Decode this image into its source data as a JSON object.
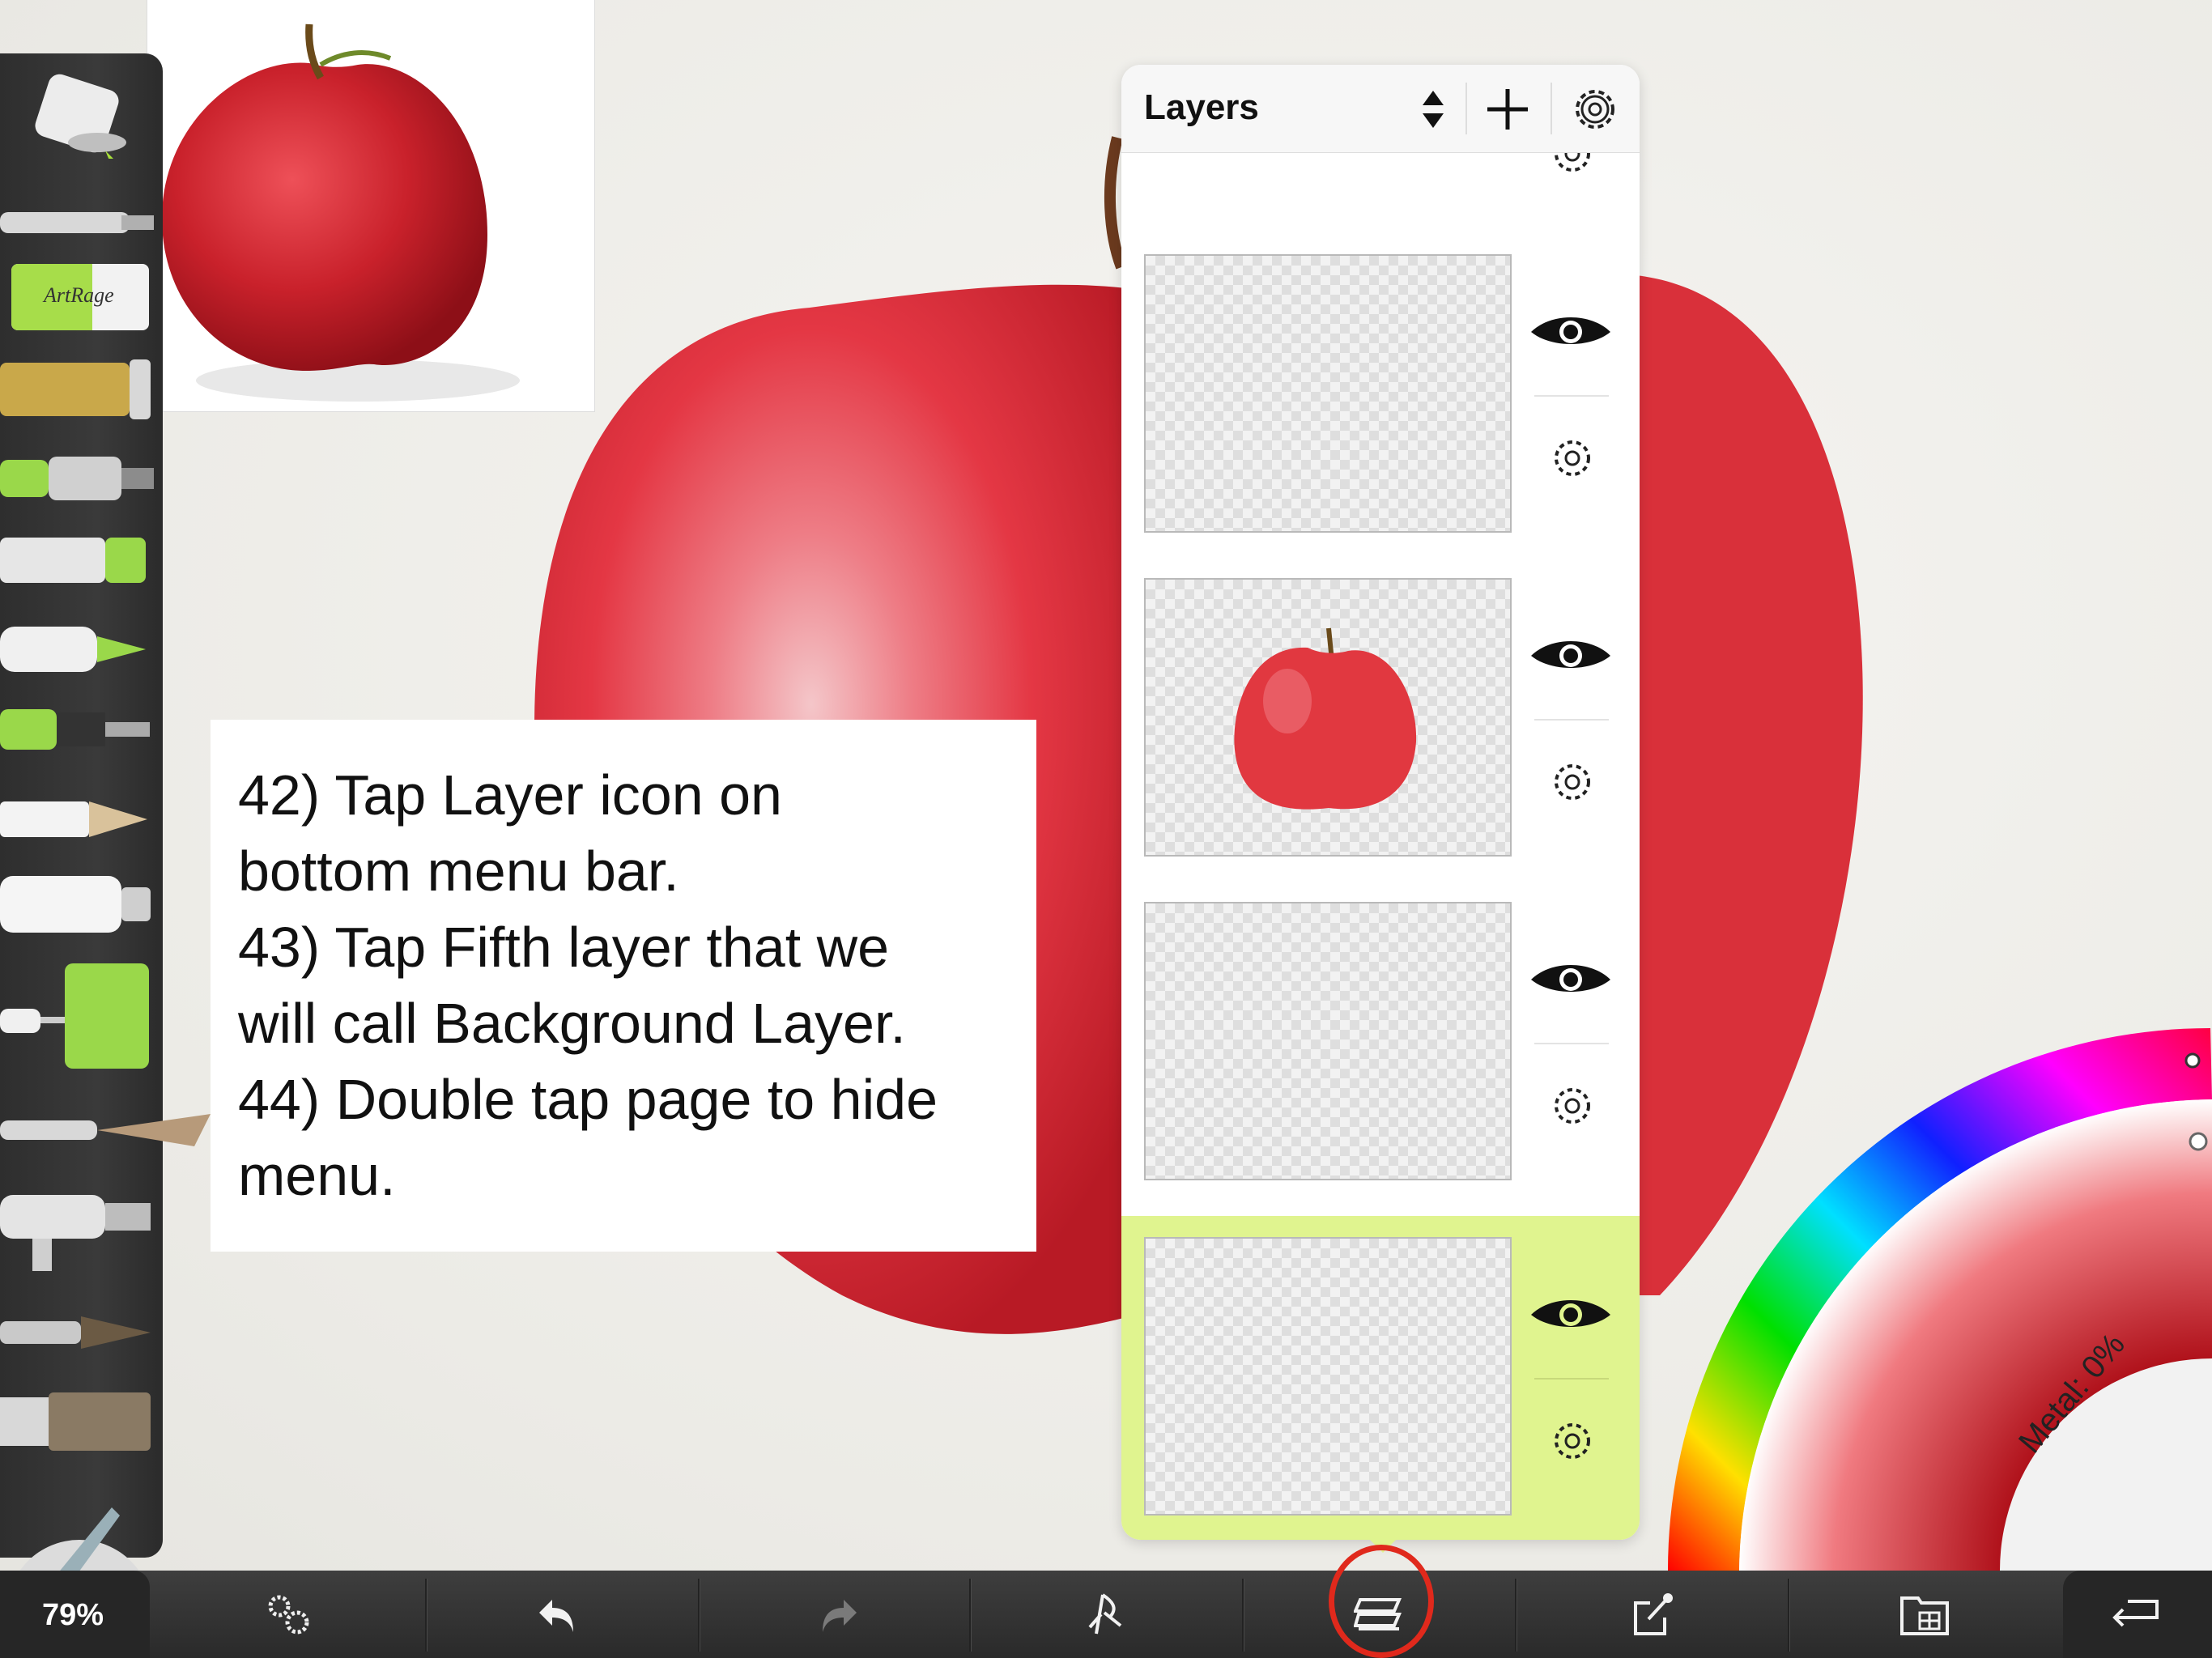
{
  "note": {
    "text": "42) Tap Layer icon on\nbottom menu bar.\n43) Tap Fifth layer that we\nwill call Background Layer.\n44) Double tap page to hide\nmenu."
  },
  "toolbox": {
    "tools": [
      "paint-roller-bucket",
      "palette-knife-pen",
      "eraser",
      "glitter-tube",
      "felt-pen",
      "crayon",
      "marker",
      "ink-pen",
      "pencil",
      "paint-tube",
      "paint-roller",
      "palette-knife",
      "airbrush",
      "watercolor-brush",
      "oil-brush"
    ],
    "eraser_brand": "ArtRage"
  },
  "layers_panel": {
    "title": "Layers",
    "layers": [
      {
        "visible": true,
        "selected": false,
        "content": "transparent"
      },
      {
        "visible": true,
        "selected": false,
        "content": "apple"
      },
      {
        "visible": true,
        "selected": false,
        "content": "transparent"
      },
      {
        "visible": true,
        "selected": true,
        "content": "transparent"
      }
    ]
  },
  "color_picker": {
    "metal_label": "Metal: 0%",
    "current_color": "#e11b22"
  },
  "bottom_bar": {
    "zoom_label": "79%",
    "buttons": [
      "settings",
      "undo",
      "redo",
      "stencils",
      "layers",
      "share",
      "gallery",
      "return"
    ],
    "highlighted": "layers"
  },
  "colors": {
    "accent_selected_layer": "#e0f48f",
    "highlight_ring": "#e0291c",
    "tool_accent": "#9ad84a"
  }
}
